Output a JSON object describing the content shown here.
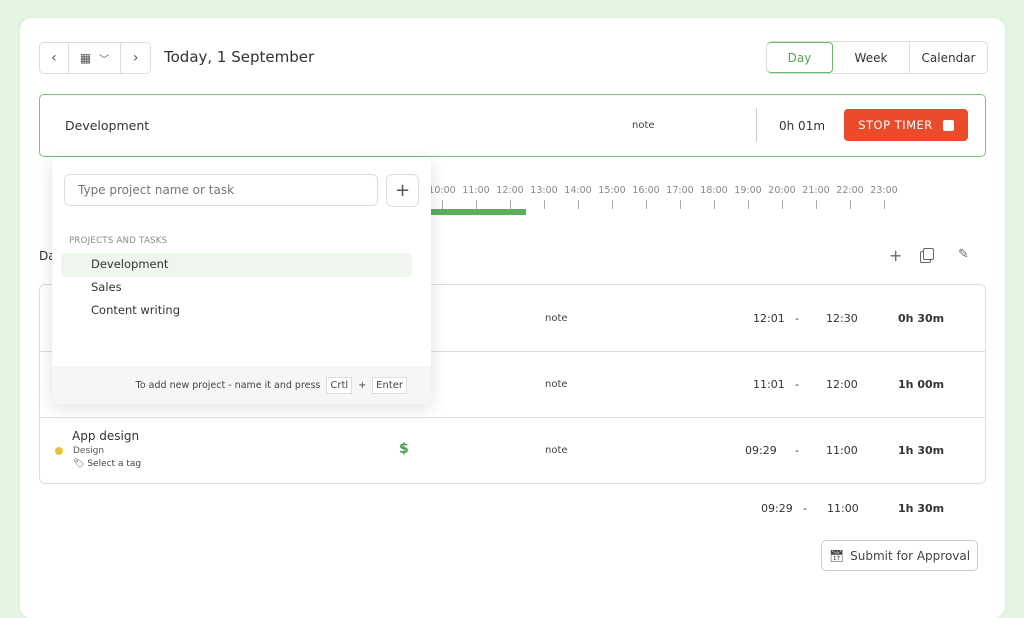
{
  "header": {
    "title": "Today, 1 September",
    "views": [
      "Day",
      "Week",
      "Calendar"
    ],
    "active_view": "Day"
  },
  "timer": {
    "project": "Development",
    "note": "note",
    "elapsed": "0h 01m",
    "stop_label": "STOP TIMER"
  },
  "timeline": {
    "hours": [
      "10:00",
      "11:00",
      "12:00",
      "13:00",
      "14:00",
      "15:00",
      "16:00",
      "17:00",
      "18:00",
      "19:00",
      "20:00",
      "21:00",
      "22:00",
      "23:00"
    ],
    "bar_color": "#5cae5c"
  },
  "section": {
    "label": "Da"
  },
  "entries": [
    {
      "note": "note",
      "start": "12:01",
      "end": "12:30",
      "duration": "0h 30m"
    },
    {
      "note": "note",
      "start": "11:01",
      "end": "12:00",
      "duration": "1h 00m"
    },
    {
      "name": "App design",
      "project": "Design",
      "tag": "Select a tag",
      "billable": "$",
      "note": "note",
      "start": "09:29",
      "end": "11:00",
      "duration": "1h 30m",
      "dot_color": "#e8c23a"
    }
  ],
  "totals": {
    "start": "09:29",
    "dash": "-",
    "end": "11:00",
    "duration": "1h 30m"
  },
  "dash": "-",
  "dropdown": {
    "placeholder": "Type project name or task",
    "section": "PROJECTS AND TASKS",
    "items": [
      "Development",
      "Sales",
      "Content writing"
    ],
    "hint": "To add new project - name it and press",
    "key1": "Crtl",
    "plus": "+",
    "key2": "Enter"
  },
  "submit_label": "Submit for Approval",
  "colors": {
    "accent": "#6cb56c",
    "stop": "#e94b2b",
    "background": "#e4f5e4"
  }
}
